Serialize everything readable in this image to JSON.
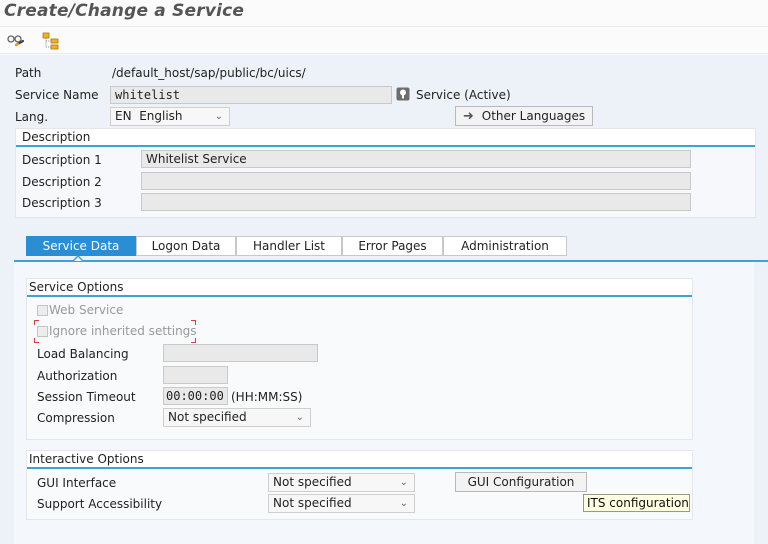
{
  "window": {
    "title": "Create/Change a Service"
  },
  "toolbar": {
    "icons": [
      {
        "name": "display-glasses-icon",
        "tooltip": ""
      },
      {
        "name": "hierarchy-tree-icon",
        "tooltip": ""
      }
    ]
  },
  "header": {
    "path_label": "Path",
    "path_value": "/default_host/sap/public/bc/uics/",
    "service_name_label": "Service Name",
    "service_name_value": "whitelist",
    "service_status": "Service (Active)",
    "lang_label": "Lang.",
    "lang_value": "EN  English",
    "other_languages_button": "Other Languages"
  },
  "description": {
    "title": "Description",
    "rows": [
      {
        "label": "Description 1",
        "value": "Whitelist Service"
      },
      {
        "label": "Description 2",
        "value": ""
      },
      {
        "label": "Description 3",
        "value": ""
      }
    ]
  },
  "tabs": [
    {
      "label": "Service Data",
      "active": true
    },
    {
      "label": "Logon Data",
      "active": false
    },
    {
      "label": "Handler List",
      "active": false
    },
    {
      "label": "Error Pages",
      "active": false
    },
    {
      "label": "Administration",
      "active": false
    }
  ],
  "service_options": {
    "title": "Service Options",
    "web_service_label": "Web Service",
    "web_service_checked": false,
    "ignore_inherited_label": "Ignore inherited settings",
    "ignore_inherited_checked": false,
    "load_balancing_label": "Load Balancing",
    "load_balancing_value": "",
    "authorization_label": "Authorization",
    "authorization_value": "",
    "session_timeout_label": "Session Timeout",
    "session_timeout_value": "00:00:00",
    "session_timeout_format": "(HH:MM:SS)",
    "compression_label": "Compression",
    "compression_value": "Not specified"
  },
  "interactive_options": {
    "title": "Interactive Options",
    "gui_interface_label": "GUI Interface",
    "gui_interface_value": "Not specified",
    "support_accessibility_label": "Support Accessibility",
    "support_accessibility_value": "Not specified",
    "gui_configuration_button": "GUI Configuration",
    "its_configuration_tooltip": "ITS configuration"
  },
  "colors": {
    "accent": "#3da3d6",
    "active_tab": "#2a8ed4",
    "focus_corner": "#d9403a",
    "tooltip_bg": "#ffffe1"
  }
}
